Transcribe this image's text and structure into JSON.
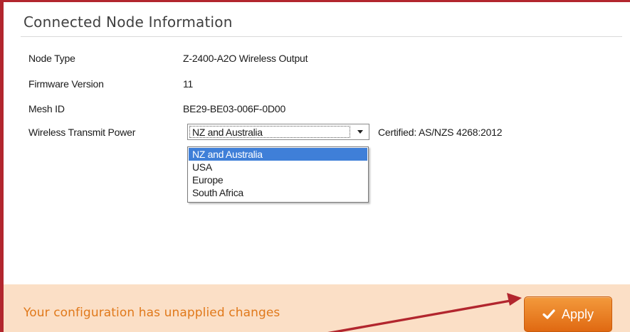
{
  "panel": {
    "title": "Connected Node Information"
  },
  "rows": {
    "node_type": {
      "label": "Node Type",
      "value": "Z-2400-A2O Wireless Output"
    },
    "firmware": {
      "label": "Firmware Version",
      "value": "11"
    },
    "mesh_id": {
      "label": "Mesh ID",
      "value": "BE29-BE03-006F-0D00"
    },
    "transmit_power": {
      "label": "Wireless Transmit Power",
      "selected": "NZ and Australia",
      "certified": "Certified: AS/NZS 4268:2012",
      "options": [
        "NZ and Australia",
        "USA",
        "Europe",
        "South Africa"
      ]
    }
  },
  "footer": {
    "message": "Your configuration has unapplied changes",
    "apply_label": "Apply"
  },
  "icons": {
    "apply": "checkmark-icon",
    "dropdown": "chevron-down-icon",
    "annotation": "arrow-annotation"
  },
  "colors": {
    "frame_border": "#b2262e",
    "footer_background": "#fbdfc6",
    "footer_text": "#e0791b",
    "apply_button": "#ef8424",
    "selection_highlight": "#3f7fd8"
  }
}
